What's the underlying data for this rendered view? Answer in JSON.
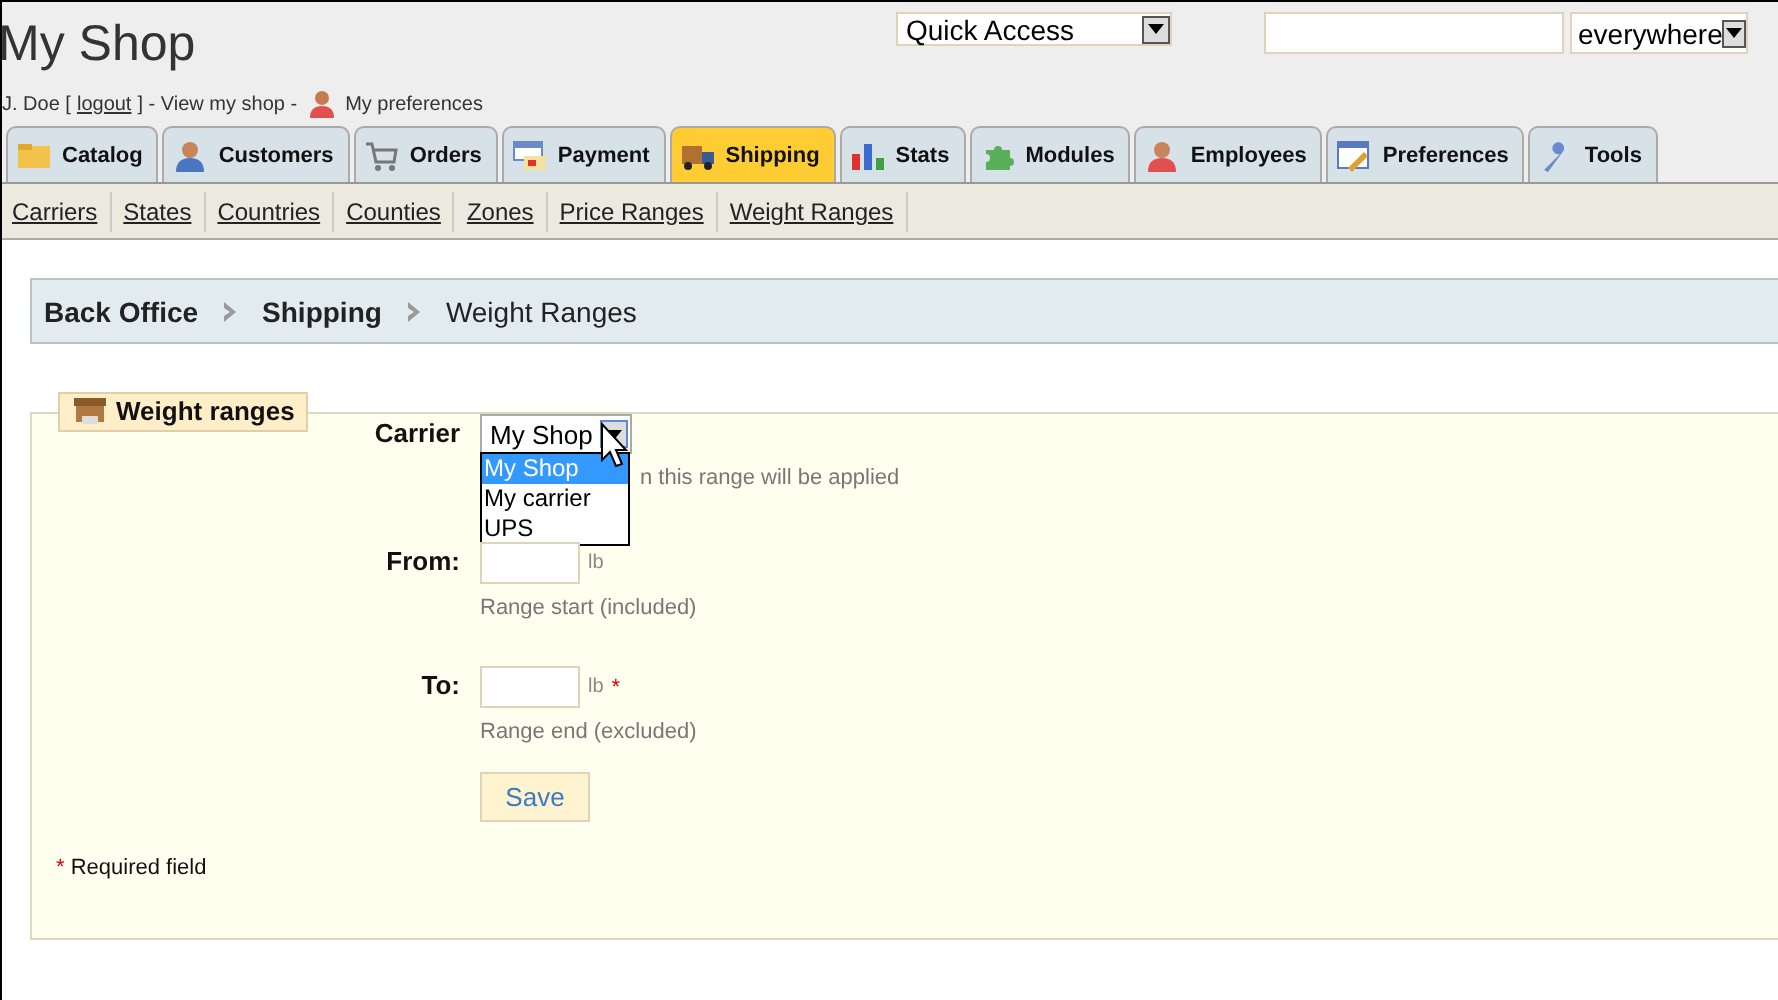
{
  "header": {
    "title": "My Shop",
    "user": "J. Doe [",
    "logout": "logout",
    "after_logout": "] - View my shop -",
    "preferences": "My preferences"
  },
  "quick_access": {
    "value": "Quick Access"
  },
  "search": {
    "scope": "everywhere"
  },
  "tabs": [
    {
      "label": "Catalog",
      "selected": false
    },
    {
      "label": "Customers",
      "selected": false
    },
    {
      "label": "Orders",
      "selected": false
    },
    {
      "label": "Payment",
      "selected": false
    },
    {
      "label": "Shipping",
      "selected": true
    },
    {
      "label": "Stats",
      "selected": false
    },
    {
      "label": "Modules",
      "selected": false
    },
    {
      "label": "Employees",
      "selected": false
    },
    {
      "label": "Preferences",
      "selected": false
    },
    {
      "label": "Tools",
      "selected": false
    }
  ],
  "subnav": [
    "Carriers",
    "States",
    "Countries",
    "Counties",
    "Zones",
    "Price Ranges",
    "Weight Ranges"
  ],
  "breadcrumb": [
    "Back Office",
    "Shipping",
    "Weight Ranges"
  ],
  "form": {
    "legend": "Weight ranges",
    "carrier": {
      "label": "Carrier",
      "value": "My Shop",
      "hint": "n this range will be applied",
      "options": [
        {
          "label": "My Shop",
          "selected": true
        },
        {
          "label": "My carrier",
          "selected": false
        },
        {
          "label": "UPS",
          "selected": false
        }
      ]
    },
    "from": {
      "label": "From:",
      "unit": "lb",
      "hint": "Range start (included)"
    },
    "to": {
      "label": "To:",
      "unit": "lb",
      "required": "*",
      "hint": "Range end (excluded)"
    },
    "save": "Save",
    "required_mark": "*",
    "required_note": "Required field"
  }
}
